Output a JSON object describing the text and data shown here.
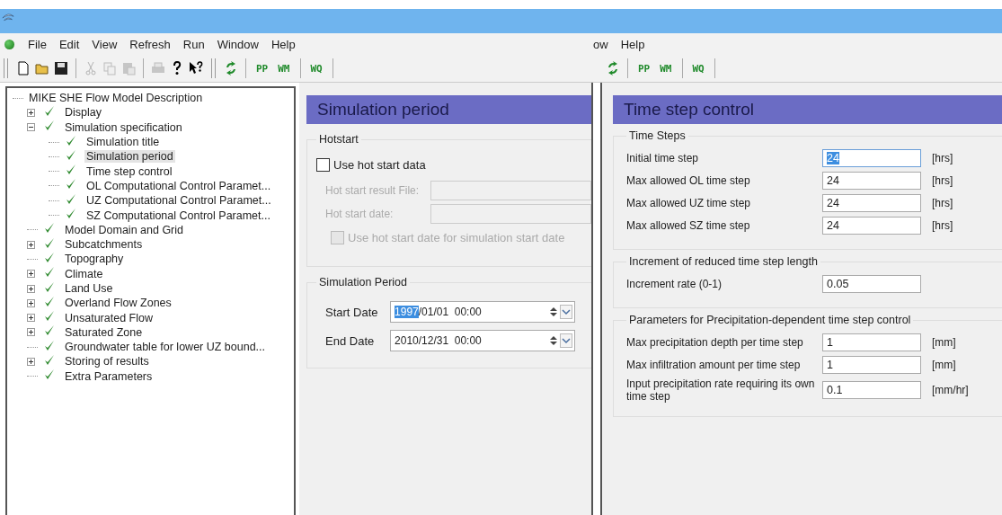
{
  "menu": [
    "File",
    "Edit",
    "View",
    "Refresh",
    "Run",
    "Window",
    "Help"
  ],
  "second_menu": [
    "ow",
    "Help"
  ],
  "toolbar": {
    "model_buttons": [
      "PP",
      "WM"
    ],
    "quality_buttons": [
      "WQ"
    ]
  },
  "second_toolbar": {
    "model_buttons": [
      "PP",
      "WM"
    ],
    "quality_buttons": [
      "WQ"
    ]
  },
  "tree": [
    {
      "label": "MIKE SHE Flow Model Description",
      "selected": false,
      "children": [
        {
          "label": "Display",
          "checked": true,
          "expanded": false,
          "selected": false
        },
        {
          "label": "Simulation specification",
          "checked": true,
          "expanded": true,
          "selected": false,
          "children": [
            {
              "label": "Simulation title",
              "checked": true,
              "selected": false
            },
            {
              "label": "Simulation period",
              "checked": true,
              "selected": true
            },
            {
              "label": "Time step control",
              "checked": true,
              "selected": false
            },
            {
              "label": "OL Computational Control Paramet...",
              "checked": true,
              "selected": false
            },
            {
              "label": "UZ Computational Control Paramet...",
              "checked": true,
              "selected": false
            },
            {
              "label": "SZ Computational Control Paramet...",
              "checked": true,
              "selected": false
            }
          ]
        },
        {
          "label": "Model Domain and Grid",
          "checked": true,
          "selected": false
        },
        {
          "label": "Subcatchments",
          "checked": true,
          "expanded": false,
          "selected": false
        },
        {
          "label": "Topography",
          "checked": true,
          "selected": false
        },
        {
          "label": "Climate",
          "checked": true,
          "expanded": false,
          "selected": false
        },
        {
          "label": "Land Use",
          "checked": true,
          "expanded": false,
          "selected": false
        },
        {
          "label": "Overland Flow Zones",
          "checked": true,
          "expanded": false,
          "selected": false
        },
        {
          "label": "Unsaturated Flow",
          "checked": true,
          "expanded": false,
          "selected": false
        },
        {
          "label": "Saturated Zone",
          "checked": true,
          "expanded": false,
          "selected": false
        },
        {
          "label": "Groundwater table for lower UZ bound...",
          "checked": true,
          "selected": false
        },
        {
          "label": "Storing of results",
          "checked": true,
          "expanded": false,
          "selected": false
        },
        {
          "label": "Extra Parameters",
          "checked": true,
          "selected": false
        }
      ]
    }
  ],
  "simulation_period": {
    "title": "Simulation period",
    "hotstart": {
      "title": "Hotstart",
      "use_checkbox": {
        "label": "Use hot start data",
        "checked": false
      },
      "fields": [
        {
          "label": "Hot start result File:",
          "disabled": true
        },
        {
          "label": "Hot start date:",
          "disabled": true
        }
      ],
      "date_checkbox": {
        "label": "Use hot start date for simulation start date",
        "checked": false,
        "disabled": true
      }
    },
    "period": {
      "title": "Simulation Period",
      "dates": [
        {
          "label": "Start Date",
          "selected_part": "1997",
          "value": "/01/01  00:00"
        },
        {
          "label": "End Date",
          "value": "2010/12/31  00:00"
        }
      ]
    }
  },
  "time_step_control": {
    "title": "Time step control",
    "groups": [
      {
        "title": "Time Steps",
        "rows": [
          {
            "label": "Initial time step",
            "value": "24",
            "unit": "[hrs]",
            "selected": true
          },
          {
            "label": "Max allowed OL time step",
            "value": "24",
            "unit": "[hrs]",
            "selected": false
          },
          {
            "label": "Max allowed UZ time step",
            "value": "24",
            "unit": "[hrs]",
            "selected": false
          },
          {
            "label": "Max allowed SZ time step",
            "value": "24",
            "unit": "[hrs]",
            "selected": false
          }
        ]
      },
      {
        "title": "Increment of reduced time step length",
        "rows": [
          {
            "label": "Increment rate  (0-1)",
            "value": "0.05",
            "selected": false
          }
        ]
      },
      {
        "title": "Parameters for Precipitation-dependent time step control",
        "rows": [
          {
            "label": "Max precipitation depth per time step",
            "value": "1",
            "unit": "[mm]",
            "selected": false
          },
          {
            "label": "Max infiltration amount per time step",
            "value": "1",
            "unit": "[mm]",
            "selected": false
          },
          {
            "label": "Input precipitation rate requiring its own time step",
            "value": "0.1",
            "unit": "[mm/hr]",
            "selected": false
          }
        ]
      }
    ]
  }
}
